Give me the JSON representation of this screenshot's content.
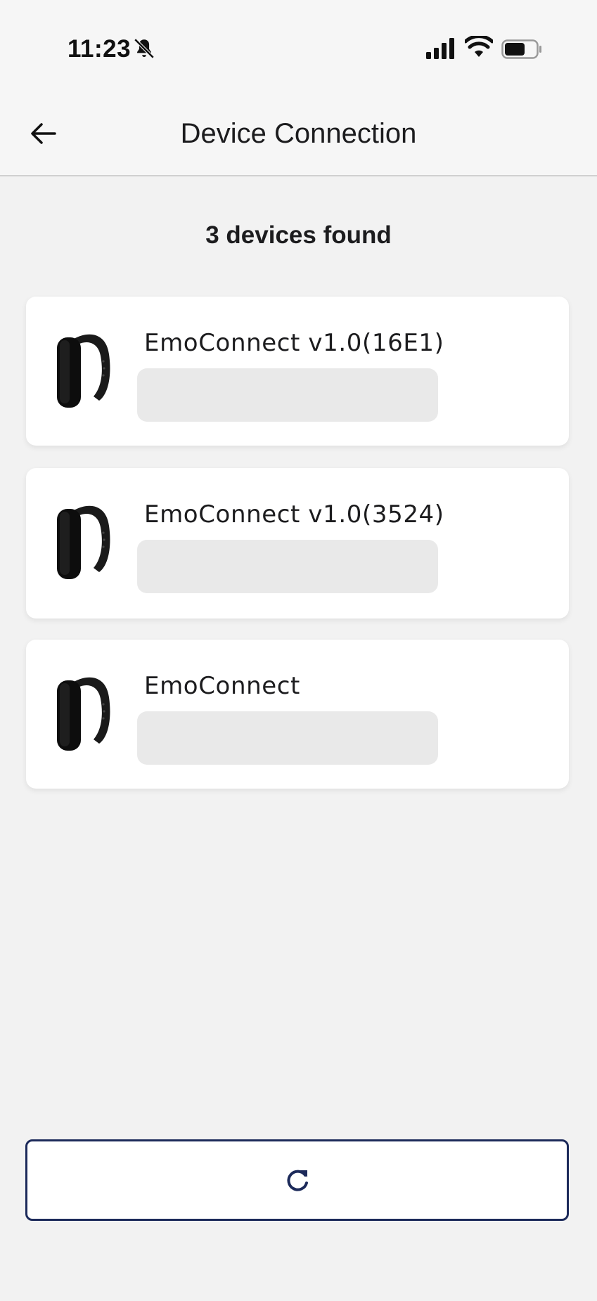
{
  "status_bar": {
    "time": "11:23",
    "icons": [
      "bell-slash-icon",
      "signal-icon",
      "wifi-icon",
      "battery-icon"
    ]
  },
  "header": {
    "title": "Device Connection",
    "back_icon": "arrow-left-icon"
  },
  "summary": {
    "count_text": "3 devices found"
  },
  "devices": [
    {
      "name": "EmoConnect v1.0(16E1)",
      "icon": "wristband-icon"
    },
    {
      "name": "EmoConnect v1.0(3524)",
      "icon": "wristband-icon"
    },
    {
      "name": "EmoConnect",
      "icon": "wristband-icon"
    }
  ],
  "refresh_button": {
    "icon": "refresh-icon"
  },
  "colors": {
    "background": "#f2f2f2",
    "card": "#ffffff",
    "placeholder": "#e9e9e9",
    "accent": "#1c2a5a"
  }
}
